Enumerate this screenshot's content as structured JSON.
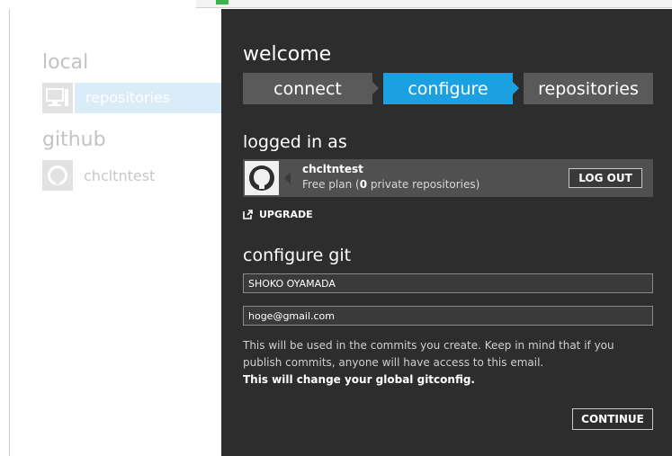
{
  "sidebar": {
    "local_label": "local",
    "local_repo_label": "repositories",
    "github_label": "github",
    "github_account_label": "chcltntest"
  },
  "main": {
    "title": "welcome",
    "steps": [
      {
        "label": "connect",
        "state": "done"
      },
      {
        "label": "configure",
        "state": "active"
      },
      {
        "label": "repositories",
        "state": "pending"
      }
    ],
    "logged_in_heading": "logged in as",
    "account": {
      "username": "chcltntest",
      "plan_prefix": "Free plan (",
      "private_count": "0",
      "plan_suffix": " private repositories)",
      "logout_label": "LOG OUT"
    },
    "upgrade_label": "UPGRADE",
    "configure_heading": "configure git",
    "name_value": "SHOKO OYAMADA",
    "email_value": "hoge@gmail.com",
    "description": "This will be used in the commits you create. Keep in mind that if you publish commits, anyone will have access to this email.",
    "warning": "This will change your global gitconfig.",
    "continue_label": "CONTINUE"
  },
  "colors": {
    "accent": "#1ba1e2",
    "panel_bg": "#2d2d2d",
    "step_inactive": "#5a5a5a"
  }
}
